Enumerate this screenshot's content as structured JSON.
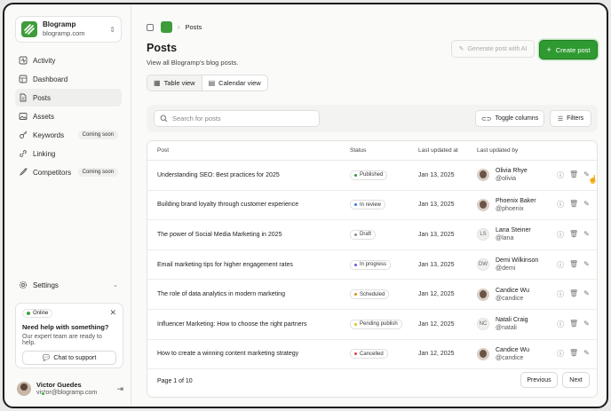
{
  "workspace": {
    "name": "Blogramp",
    "domain": "blogramp.com"
  },
  "nav": [
    {
      "label": "Activity",
      "icon": "activity-icon",
      "badge": ""
    },
    {
      "label": "Dashboard",
      "icon": "dashboard-icon",
      "badge": ""
    },
    {
      "label": "Posts",
      "icon": "posts-icon",
      "badge": "",
      "active": true
    },
    {
      "label": "Assets",
      "icon": "image-icon",
      "badge": ""
    },
    {
      "label": "Keywords",
      "icon": "key-icon",
      "badge": "Coming soon"
    },
    {
      "label": "Linking",
      "icon": "link-icon",
      "badge": ""
    },
    {
      "label": "Competitors",
      "icon": "rocket-icon",
      "badge": "Coming soon"
    }
  ],
  "settings_label": "Settings",
  "help": {
    "status": "Online",
    "title": "Need help with something?",
    "subtitle": "Our expert team are ready to help.",
    "button": "Chat to support"
  },
  "user": {
    "name": "Victor Guedes",
    "email": "victor@blogramp.com"
  },
  "breadcrumb": {
    "current": "Posts"
  },
  "page": {
    "title": "Posts",
    "subtitle": "View all Blogramp's blog posts."
  },
  "actions": {
    "generate": "Generate post with AI",
    "create": "Create post"
  },
  "views": {
    "table": "Table view",
    "calendar": "Calendar view"
  },
  "search": {
    "placeholder": "Search for posts"
  },
  "toolbar": {
    "toggle_columns": "Toggle columns",
    "filters": "Filters"
  },
  "table": {
    "headers": {
      "post": "Post",
      "status": "Status",
      "updated_at": "Last updated at",
      "updated_by": "Last updated by"
    },
    "rows": [
      {
        "post": "Understanding SEO: Best practices for 2025",
        "status": "Published",
        "status_color": "#2f9a31",
        "date": "Jan 13, 2025",
        "user": "Olivia Rhye",
        "handle": "@olivia",
        "initials": ""
      },
      {
        "post": "Building brand loyalty through customer experience",
        "status": "In review",
        "status_color": "#2f7ae0",
        "date": "Jan 13, 2025",
        "user": "Phoenix Baker",
        "handle": "@phoenix",
        "initials": ""
      },
      {
        "post": "The power of Social Media Marketing in 2025",
        "status": "Draft",
        "status_color": "#8a8a8a",
        "date": "Jan 13, 2025",
        "user": "Lana Steiner",
        "handle": "@lana",
        "initials": "LS"
      },
      {
        "post": "Email marketing tips for higher engagement rates",
        "status": "In progress",
        "status_color": "#7a4fe0",
        "date": "Jan 13, 2025",
        "user": "Demi Wilkinson",
        "handle": "@demi",
        "initials": "DW"
      },
      {
        "post": "The role of data analytics in modern marketing",
        "status": "Scheduled",
        "status_color": "#e08a1f",
        "date": "Jan 12, 2025",
        "user": "Candice Wu",
        "handle": "@candice",
        "initials": ""
      },
      {
        "post": "Influencer Marketing: How to choose the right partners",
        "status": "Pending publish",
        "status_color": "#e0c21f",
        "date": "Jan 12, 2025",
        "user": "Natali Craig",
        "handle": "@natali",
        "initials": "NC"
      },
      {
        "post": "How to create a winning content marketing strategy",
        "status": "Cancelled",
        "status_color": "#e0443a",
        "date": "Jan 12, 2025",
        "user": "Candice Wu",
        "handle": "@candice",
        "initials": ""
      }
    ]
  },
  "pagination": {
    "info": "Page 1 of 10",
    "previous": "Previous",
    "next": "Next"
  }
}
